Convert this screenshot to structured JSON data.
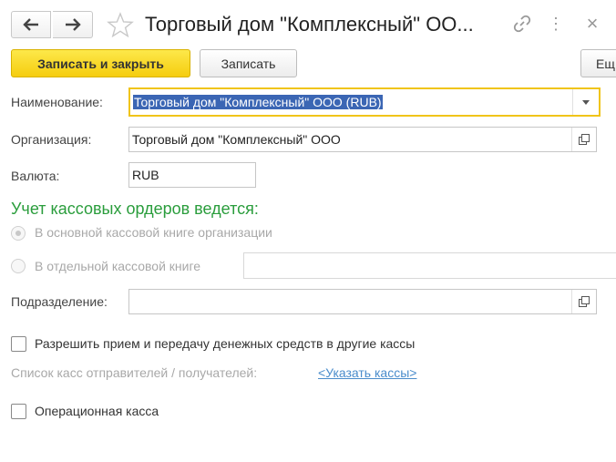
{
  "window": {
    "title": "Торговый дом \"Комплексный\" ОО...",
    "back_icon": "arrow-left-icon",
    "forward_icon": "arrow-right-icon",
    "favorite_icon": "star-icon",
    "link_icon": "link-icon",
    "more_icon": "more-icon",
    "close_icon": "close-icon",
    "more_symbol": "⋮",
    "close_symbol": "×"
  },
  "toolbar": {
    "save_close_label": "Записать и закрыть",
    "save_label": "Записать",
    "more_label": "Ещ"
  },
  "form": {
    "name_label": "Наименование:",
    "name_value": "Торговый дом \"Комплексный\" ООО (RUB)",
    "org_label": "Организация:",
    "org_value": "Торговый дом \"Комплексный\" ООО",
    "currency_label": "Валюта:",
    "currency_value": "RUB",
    "section_title": "Учет кассовых ордеров ведется:",
    "radio_main_label": "В основной кассовой книге организации",
    "radio_separate_label": "В отдельной кассовой книге",
    "separate_book_value": "",
    "division_label": "Подразделение:",
    "division_value": "",
    "allow_transfer_label": "Разрешить прием и передачу денежных средств в другие кассы",
    "allow_transfer_checked": false,
    "cash_list_label": "Список касс отправителей / получателей:",
    "cash_list_link": "<Указать кассы>",
    "operational_label": "Операционная касса",
    "operational_checked": false
  },
  "colors": {
    "accent_yellow": "#f5cd0f",
    "section_green": "#2a9d3c",
    "selection_blue": "#3b66b4",
    "link_blue": "#4a8ccb",
    "focus_border": "#f0c419"
  }
}
